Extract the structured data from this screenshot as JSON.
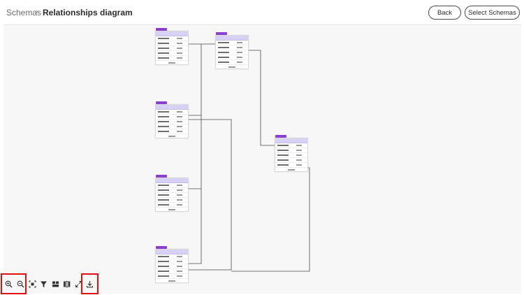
{
  "breadcrumb": {
    "root": "Schemas",
    "separator": "›",
    "current": "Relationships diagram"
  },
  "actions": {
    "back_label": "Back",
    "select_schemas_label": "Select Schemas"
  },
  "toolbar": {
    "tools": [
      "zoom-in-icon",
      "zoom-out-icon",
      "fit-to-screen-icon",
      "filter-icon",
      "layout-icon",
      "columns-icon",
      "expand-icon",
      "download-icon"
    ]
  },
  "colors": {
    "schema_header": "#d7d1f5",
    "schema_tag": "#8a3fd1",
    "highlight": "#e01010"
  }
}
